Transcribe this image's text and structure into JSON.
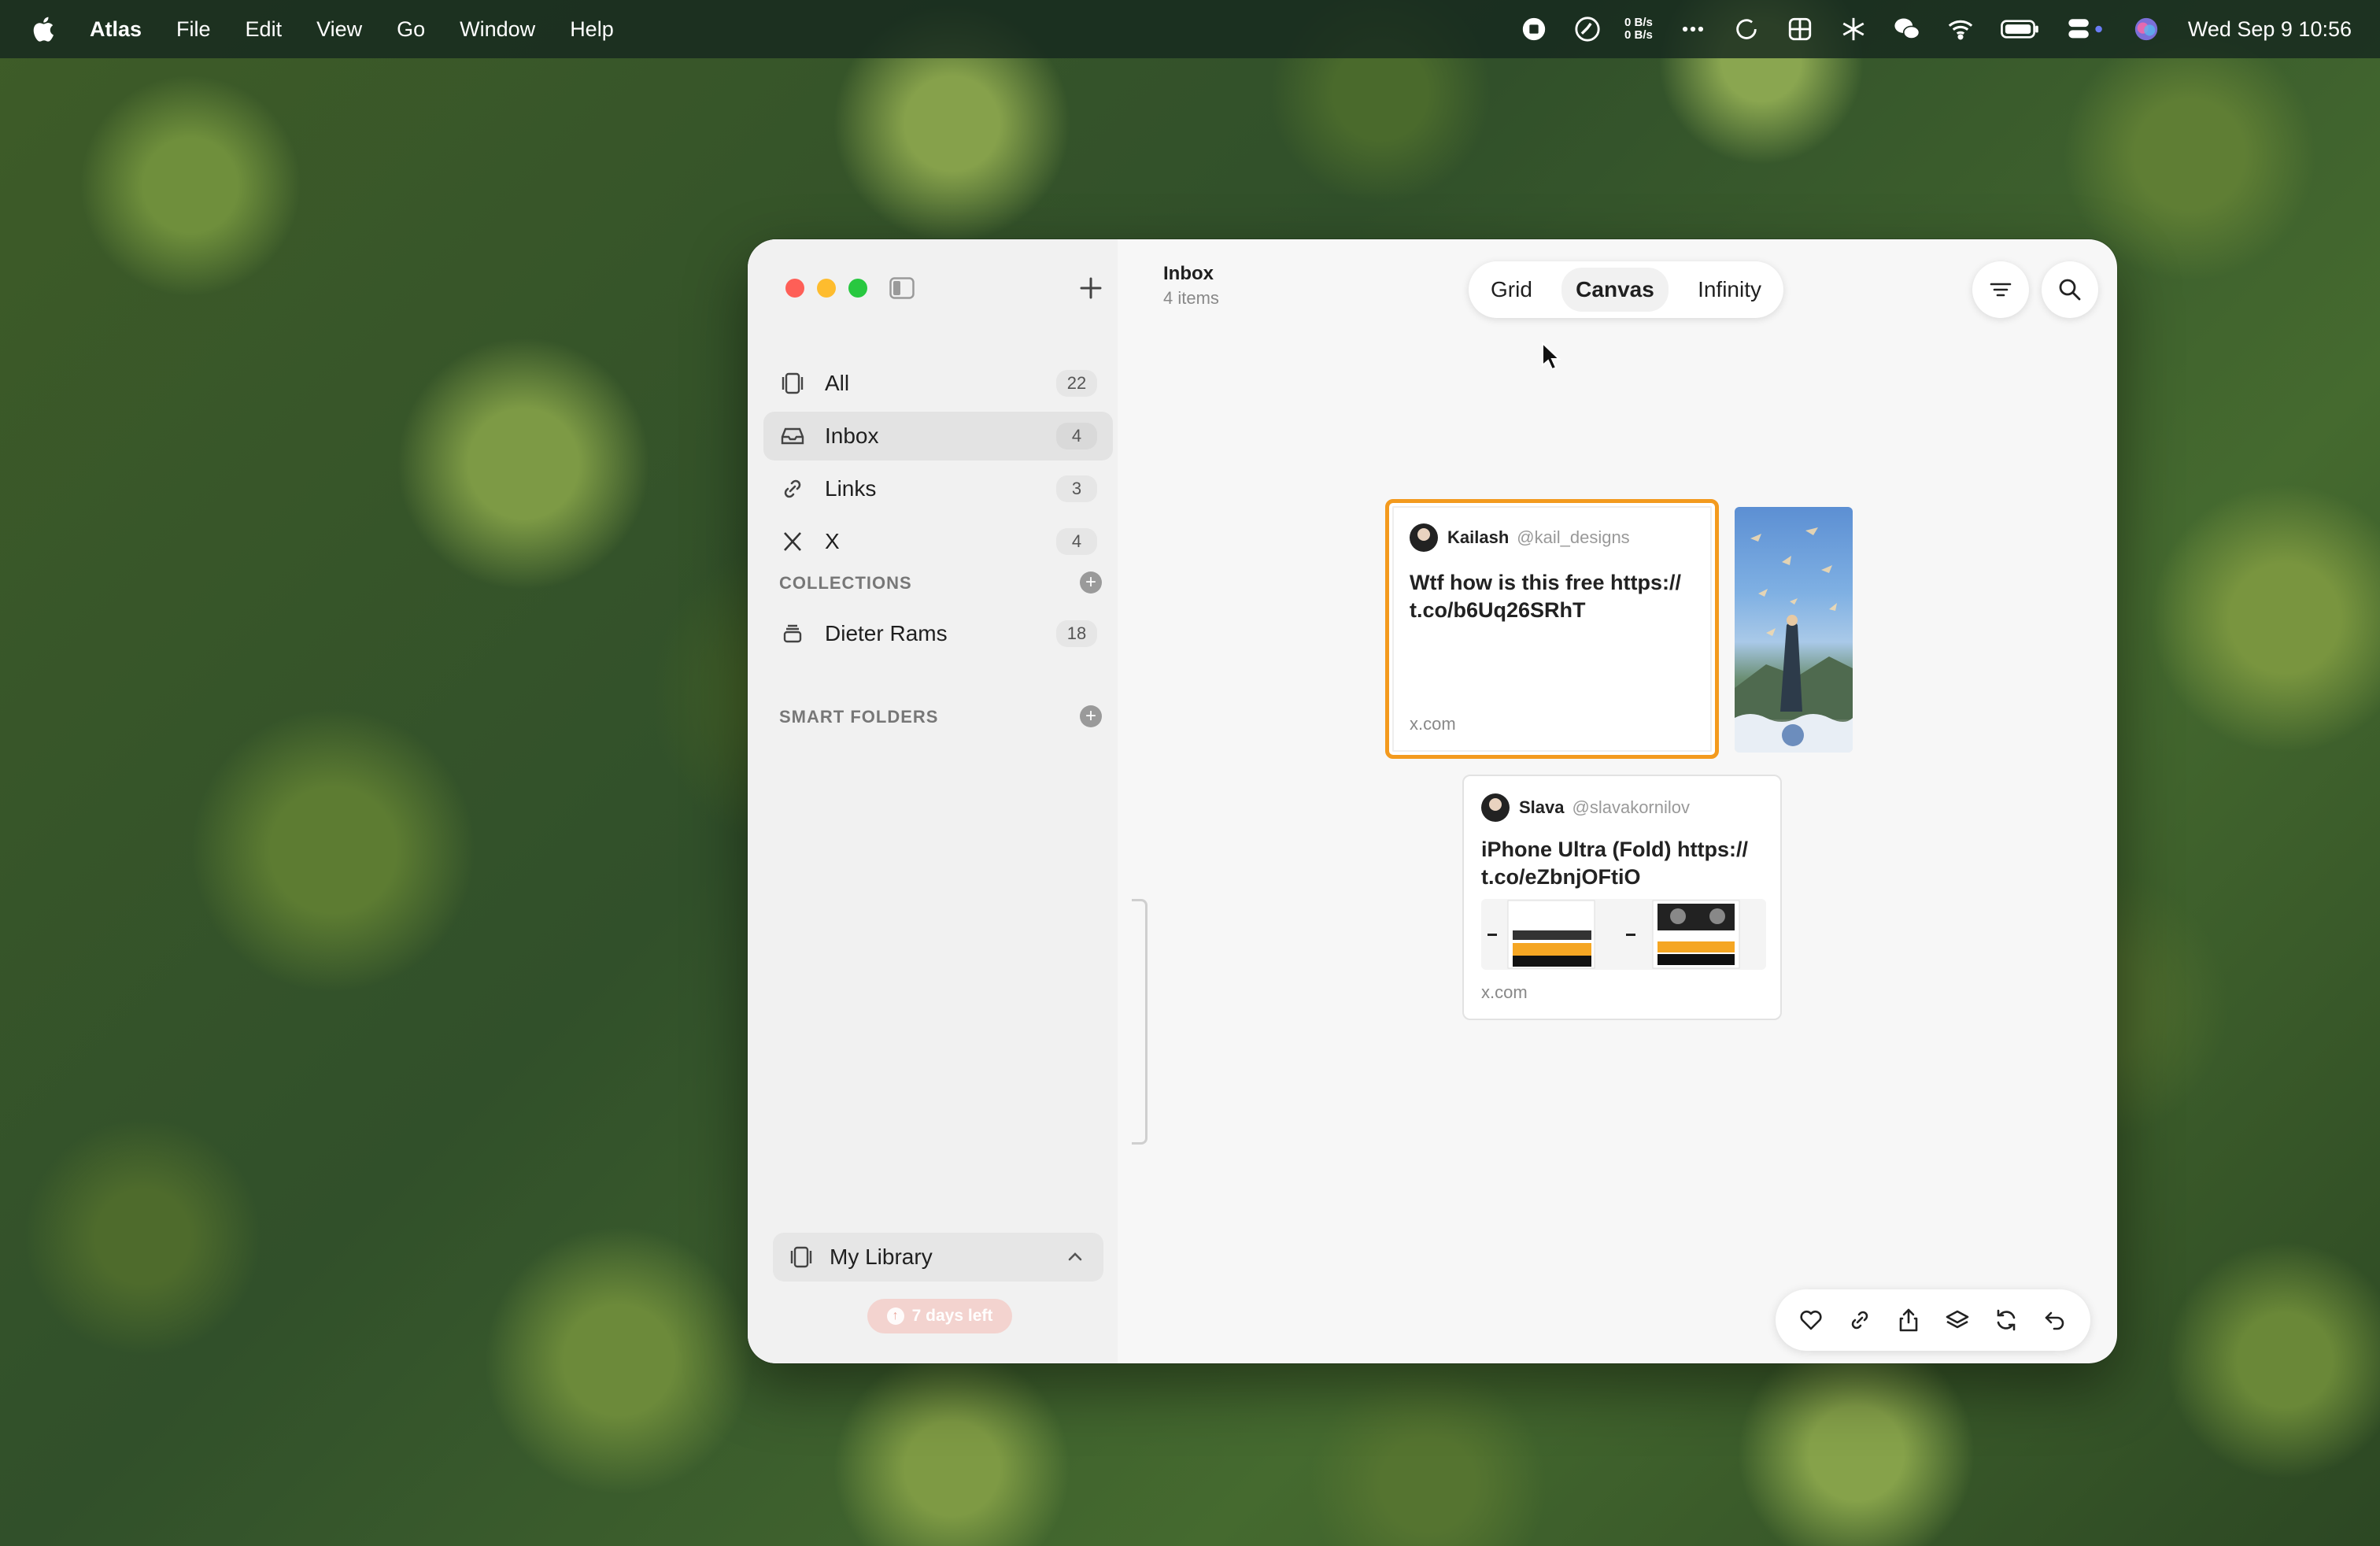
{
  "menubar": {
    "app_name": "Atlas",
    "items": [
      "File",
      "Edit",
      "View",
      "Go",
      "Window",
      "Help"
    ],
    "net_up": "0 B/s",
    "net_down": "0 B/s",
    "clock": "Wed Sep 9  10:56",
    "status_icons": [
      "record-icon",
      "speedometer-icon",
      "net-speed",
      "more-icon",
      "sync-icon",
      "grid-icon",
      "snowflake-icon",
      "wechat-icon",
      "wifi-icon",
      "battery-icon",
      "control-center-icon",
      "siri-icon"
    ]
  },
  "sidebar": {
    "nav": [
      {
        "label": "All",
        "count": "22",
        "icon": "library-icon"
      },
      {
        "label": "Inbox",
        "count": "4",
        "icon": "inbox-icon"
      },
      {
        "label": "Links",
        "count": "3",
        "icon": "link-icon"
      },
      {
        "label": "X",
        "count": "4",
        "icon": "x-logo-icon"
      }
    ],
    "collections_title": "COLLECTIONS",
    "collections": [
      {
        "label": "Dieter Rams",
        "count": "18",
        "icon": "stack-icon"
      }
    ],
    "smart_folders_title": "SMART FOLDERS",
    "library_label": "My Library",
    "trial_label": "7 days left"
  },
  "header": {
    "title": "Inbox",
    "subtitle": "4 items"
  },
  "view_switch": {
    "options": [
      "Grid",
      "Canvas",
      "Infinity"
    ],
    "selected": "Canvas"
  },
  "cards": [
    {
      "author": "Kailash",
      "handle": "@kail_designs",
      "text_line1": "Wtf how is this free https://",
      "text_line2": "t.co/b6Uq26SRhT",
      "domain": "x.com"
    },
    {
      "author": "Slava",
      "handle": "@slavakornilov",
      "text_line1": "iPhone Ultra (Fold) https://",
      "text_line2": "t.co/eZbnjOFtiO",
      "domain": "x.com"
    }
  ],
  "toolbar": [
    "heart-icon",
    "link-icon",
    "share-icon",
    "layers-icon",
    "refresh-icon",
    "undo-icon"
  ],
  "colors": {
    "selection": "#f39a1e",
    "trial_badge": "#f3d3cf"
  }
}
